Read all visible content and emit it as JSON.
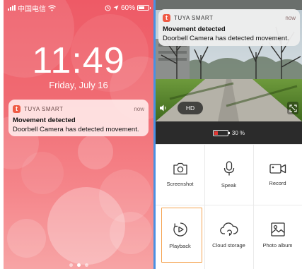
{
  "lock_screen": {
    "status": {
      "carrier": "中国电信",
      "icons": [
        "signal-icon",
        "wifi-icon",
        "location-icon",
        "alarm-icon"
      ],
      "battery": "60%",
      "battery_level": 0.6
    },
    "time": "11:49",
    "date": "Friday, July 16",
    "notification": {
      "app_name": "TUYA SMART",
      "time": "now",
      "title": "Movement detected",
      "body": "Doorbell Camera has detected movement."
    },
    "page_count": 3,
    "active_page": 1
  },
  "camera_app": {
    "notification": {
      "app_name": "TUYA SMART",
      "time": "now",
      "title": "Movement detected",
      "body": "Doorbell Camera has detected movement."
    },
    "video": {
      "quality": "HD",
      "icons": [
        "speaker-icon",
        "fullscreen-icon"
      ]
    },
    "battery": {
      "text": "30 %",
      "level": 0.3,
      "color": "#e53935"
    },
    "actions": [
      {
        "label": "Screenshot",
        "icon": "camera-icon"
      },
      {
        "label": "Speak",
        "icon": "microphone-icon"
      },
      {
        "label": "Record",
        "icon": "video-record-icon"
      },
      {
        "label": "Playback",
        "icon": "playback-icon",
        "highlighted": true
      },
      {
        "label": "Cloud storage",
        "icon": "cloud-storage-icon"
      },
      {
        "label": "Photo album",
        "icon": "photo-album-icon"
      }
    ]
  },
  "colors": {
    "accent": "#ef5b45",
    "highlight_border": "#f5a350",
    "divider": "#4a90e2"
  }
}
